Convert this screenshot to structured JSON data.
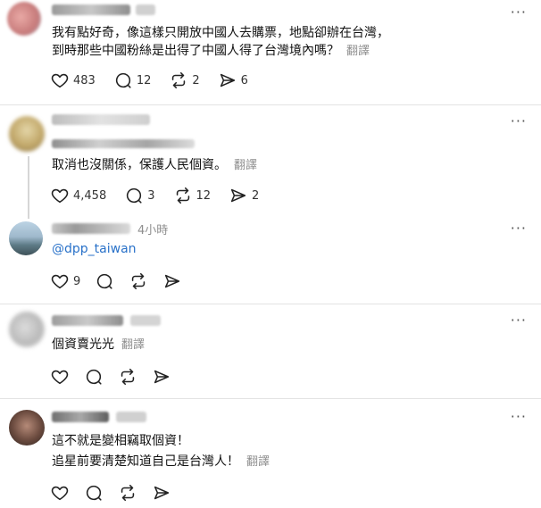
{
  "more_label": "···",
  "posts": [
    {
      "lines": [
        "我有點好奇，像這樣只開放中國人去購票，地點卻辦在台灣，",
        "到時那些中國粉絲是出得了中國人得了台灣境內嗎？"
      ],
      "translate": "翻譯",
      "stats": {
        "likes": "483",
        "replies": "12",
        "reposts": "2",
        "shares": "6"
      }
    },
    {
      "lines": [
        "取消也沒關係，保護人民個資。"
      ],
      "translate": "翻譯",
      "stats": {
        "likes": "4,458",
        "replies": "3",
        "reposts": "12",
        "shares": "2"
      }
    },
    {
      "time": "4小時",
      "mention": "@dpp_taiwan",
      "stats": {
        "likes": "9"
      }
    },
    {
      "lines": [
        "個資賣光光"
      ],
      "translate": "翻譯"
    },
    {
      "lines": [
        "這不就是變相竊取個資！",
        "追星前要清楚知道自己是台灣人！"
      ],
      "translate": "翻譯"
    }
  ]
}
